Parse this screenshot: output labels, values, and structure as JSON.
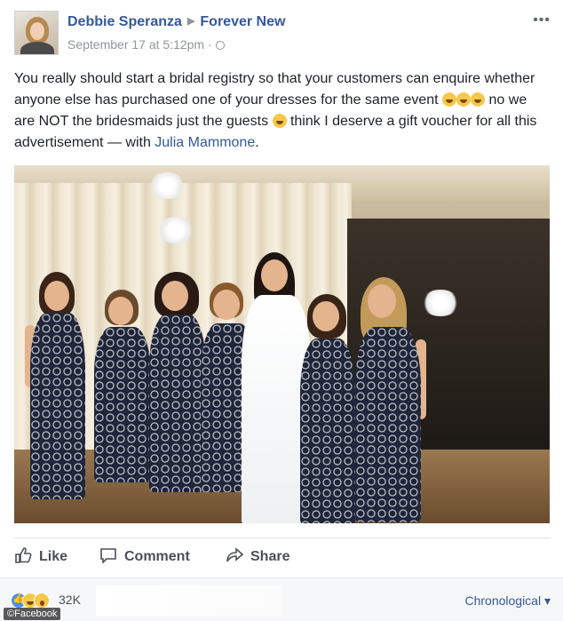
{
  "post": {
    "author": "Debbie Speranza",
    "page": "Forever New",
    "timestamp": "September 17 at 5:12pm",
    "more_label": "•••",
    "text_part1": "You really should start a bridal registry so that your customers can enquire whether anyone else has purchased one of your dresses for the same event ",
    "text_part2": " no we are NOT the bridesmaids just the guests ",
    "text_part3": " think I deserve a gift voucher for all this advertisement — with ",
    "tagged": "Julia Mammone",
    "text_end": "."
  },
  "actions": {
    "like_label": "Like",
    "comment_label": "Comment",
    "share_label": "Share"
  },
  "footer": {
    "reaction_count": "32K",
    "reaction_icons": [
      "like-icon",
      "haha-icon",
      "wow-icon"
    ],
    "sort_label": "Chronological ▾"
  },
  "watermark": "©Facebook",
  "colors": {
    "link": "#365899",
    "text": "#1d2129",
    "muted": "#90949c"
  }
}
